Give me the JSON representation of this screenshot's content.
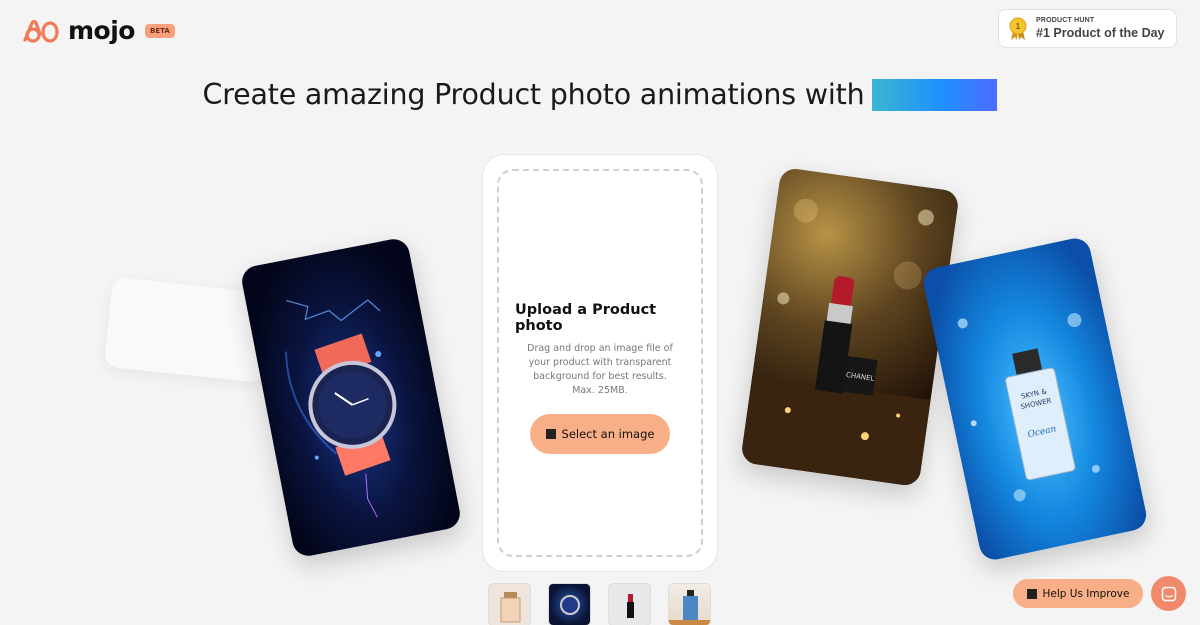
{
  "header": {
    "logo_text": "mojo",
    "beta_label": "BETA",
    "product_hunt": {
      "small_label": "PRODUCT HUNT",
      "title": "#1 Product of the Day",
      "medal_number": "1"
    }
  },
  "hero": {
    "headline": "Create amazing Product photo animations with"
  },
  "upload": {
    "title": "Upload a Product photo",
    "description": "Drag and drop an image file of your product with transparent background for best results. Max. 25MB.",
    "button_label": "Select an image"
  },
  "showcase": {
    "lipstick_brand": "CHANEL",
    "perfume_label": [
      "SKYN &",
      "SHOWER",
      "Ocean"
    ]
  },
  "thumbnails": [
    {
      "name": "perfume-beige"
    },
    {
      "name": "watch-blue"
    },
    {
      "name": "lipstick-gray"
    },
    {
      "name": "perfume-ocean"
    }
  ],
  "footer": {
    "help_label": "Help Us Improve"
  },
  "colors": {
    "accent": "#f8ae86",
    "chat": "#f08a6a",
    "gradient_start": "#3bb6cf",
    "gradient_end": "#4d6bff"
  }
}
